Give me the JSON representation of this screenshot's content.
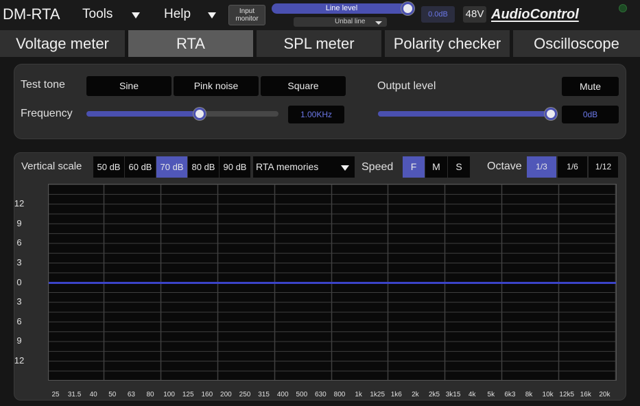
{
  "app": {
    "title": "DM-RTA",
    "menus": [
      {
        "label": "Tools"
      },
      {
        "label": "Help"
      }
    ],
    "input_monitor_label": "Input monitor",
    "input_level": {
      "label": "Line level",
      "value_fraction": 1.0
    },
    "input_type": "Unbal line",
    "gain_readout": "0.0dB",
    "phantom_power": "48V",
    "brand": "AudioControl"
  },
  "tabs": [
    {
      "label": "Voltage meter",
      "active": false
    },
    {
      "label": "RTA",
      "active": true
    },
    {
      "label": "SPL meter",
      "active": false
    },
    {
      "label": "Polarity checker",
      "active": false
    },
    {
      "label": "Oscilloscope",
      "active": false
    }
  ],
  "tone": {
    "test_tone_label": "Test tone",
    "tones": [
      {
        "label": "Sine"
      },
      {
        "label": "Pink noise"
      },
      {
        "label": "Square"
      }
    ],
    "frequency_label": "Frequency",
    "frequency_value": "1.00KHz",
    "frequency_fraction": 0.59,
    "output_level_label": "Output level",
    "output_value": "0dB",
    "output_fraction": 1.0,
    "mute_label": "Mute"
  },
  "rta": {
    "vertical_scale_label": "Vertical scale",
    "scales": [
      {
        "label": "50 dB",
        "selected": false
      },
      {
        "label": "60 dB",
        "selected": false
      },
      {
        "label": "70 dB",
        "selected": true
      },
      {
        "label": "80 dB",
        "selected": false
      },
      {
        "label": "90 dB",
        "selected": false
      }
    ],
    "memories_label": "RTA memories",
    "speed_label": "Speed",
    "speeds": [
      {
        "label": "F",
        "selected": true
      },
      {
        "label": "M",
        "selected": false
      },
      {
        "label": "S",
        "selected": false
      }
    ],
    "octave_label": "Octave",
    "octaves": [
      {
        "label": "1/3",
        "selected": true
      },
      {
        "label": "1/6",
        "selected": false
      },
      {
        "label": "1/12",
        "selected": false
      }
    ],
    "y_ticks": [
      "12",
      "9",
      "6",
      "3",
      "0",
      "3",
      "6",
      "9",
      "12"
    ],
    "x_ticks": [
      "25",
      "31.5",
      "40",
      "50",
      "63",
      "80",
      "100",
      "125",
      "160",
      "200",
      "250",
      "315",
      "400",
      "500",
      "630",
      "800",
      "1k",
      "1k25",
      "1k6",
      "2k",
      "2k5",
      "3k15",
      "4k",
      "5k",
      "6k3",
      "8k",
      "10k",
      "12k5",
      "16k",
      "20k"
    ],
    "trace_level_db": 0,
    "colors": {
      "accent": "#4a50b0",
      "trace": "#3b43c8",
      "grid": "#3f3f3f",
      "plot_bg": "#0a0a0a"
    }
  }
}
